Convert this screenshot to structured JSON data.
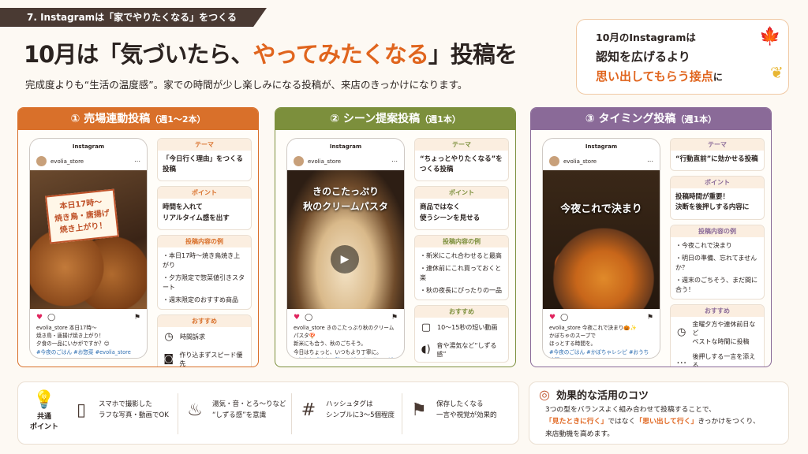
{
  "tag": "7. Instagramは「家でやりたくなる」をつくる",
  "title": {
    "pre": "10月は「気づいたら、",
    "accent": "やってみたくなる",
    "post": "」投稿を"
  },
  "subtitle": "完成度よりも“生活の温度感”。家での時間が少し楽しみになる投稿が、来店のきっかけになります。",
  "note": {
    "l1": "10月のInstagramは",
    "l2": "認知を広げるより",
    "l3": "思い出してもらう接点",
    "l3s": "に"
  },
  "columns": [
    {
      "head": "① 売場連動投稿",
      "freq": "（週1〜2本）",
      "color": "#d9702a",
      "ig": "Instagram",
      "user": "evolia_store",
      "img_text": "本日17時〜\n焼き鳥・唐揚げ\n焼き上がり！",
      "cap1": "evolia_store  本日17時〜",
      "cap2": "焼き鳥・唐揚げ焼き上がり！",
      "cap3": "夕食の一品にいかがですか？😊",
      "tags": "#今夜のごはん #お惣菜 #evolia_store",
      "theme_h": "テーマ",
      "theme": "「今日行く理由」をつくる投稿",
      "point_h": "ポイント",
      "point": "時間を入れて\nリアルタイム感を出す",
      "ex_h": "投稿内容の例",
      "ex": [
        "・本日17時〜焼き鳥焼き上がり",
        "・夕方限定で惣菜値引きスタート",
        "・週末限定のおすすめ商品"
      ],
      "rec_h": "おすすめ",
      "rec": [
        {
          "icon": "clock-icon",
          "g": "◷",
          "t": "時間訴求"
        },
        {
          "icon": "camera-icon",
          "g": "◙",
          "t": "作り込まずスピード優先"
        }
      ]
    },
    {
      "head": "② シーン提案投稿",
      "freq": "（週1本）",
      "color": "#7c8f3c",
      "ig": "Instagram",
      "user": "evolia_store",
      "img_text": "きのこたっぷり\n秋のクリームパスタ",
      "cap1": "evolia_store  きのこたっぷり秋のクリームパスタ🍄",
      "cap2": "新米にも合う、秋のごちそう。",
      "cap3": "今日はちょっと、いつもより丁寧に。",
      "tags": "#おうちごはん #秋レシピ #きのこレシピ",
      "theme_h": "テーマ",
      "theme": "“ちょっとやりたくなる”を\nつくる投稿",
      "point_h": "ポイント",
      "point": "商品ではなく\n使うシーンを見せる",
      "ex_h": "投稿内容の例",
      "ex": [
        "・新米にこれ合わせると最高",
        "・連休前にこれ買っておくと楽",
        "・秋の夜長にぴったりの一品"
      ],
      "rec_h": "おすすめ",
      "rec": [
        {
          "icon": "video-icon",
          "g": "▢",
          "t": "10〜15秒の短い動画"
        },
        {
          "icon": "sound-icon",
          "g": "◖)",
          "t": "音や湯気など“しずる感”"
        }
      ]
    },
    {
      "head": "③ タイミング投稿",
      "freq": "（週1本）",
      "color": "#8a6a98",
      "ig": "Instagram",
      "user": "evolia_store",
      "img_text": "今夜これで決まり",
      "cap1": "evolia_store  今夜これで決まり🎃✨",
      "cap2": "かぼちゃのスープで",
      "cap3": "ほっとする時間を。",
      "tags": "#今夜のごはん #かぼちゃレシピ #おうち時間",
      "theme_h": "テーマ",
      "theme": "“行動直前”に効かせる投稿",
      "point_h": "ポイント",
      "point": "投稿時間が重要！\n決断を後押しする内容に",
      "ex_h": "投稿内容の例",
      "ex": [
        "・今夜これで決まり",
        "・明日の準備、忘れてませんか？",
        "・週末のごちそう、まだ間に合う！"
      ],
      "rec_h": "おすすめ",
      "rec": [
        {
          "icon": "clock-icon",
          "g": "◷",
          "t": "金曜夕方や連休前日など\nベストな時間に投稿"
        },
        {
          "icon": "chat-icon",
          "g": "…",
          "t": "後押しする一言を添える"
        }
      ]
    }
  ],
  "common": {
    "label": "共通\nポイント",
    "points": [
      {
        "icon": "smartphone-icon",
        "g": "▯",
        "t": "スマホで撮影した\nラフな写真・動画でOK"
      },
      {
        "icon": "steam-icon",
        "g": "♨",
        "t": "湯気・音・とろ〜りなど\n“しずる感”を意識"
      },
      {
        "icon": "hashtag-icon",
        "g": "#",
        "t": "ハッシュタグは\nシンプルに3〜5個程度"
      },
      {
        "icon": "bookmark-icon",
        "g": "⚑",
        "t": "保存したくなる\n一言や視覚が効果的"
      }
    ]
  },
  "tips": {
    "head": "効果的な活用のコツ",
    "l1": "3つの型をバランスよく組み合わせて投稿することで、",
    "l2a": "「見たときに行く」",
    "l2b": "ではなく",
    "l2c": "「思い出して行く」",
    "l2d": "きっかけをつくり、",
    "l3": "来店動機を高めます。"
  }
}
